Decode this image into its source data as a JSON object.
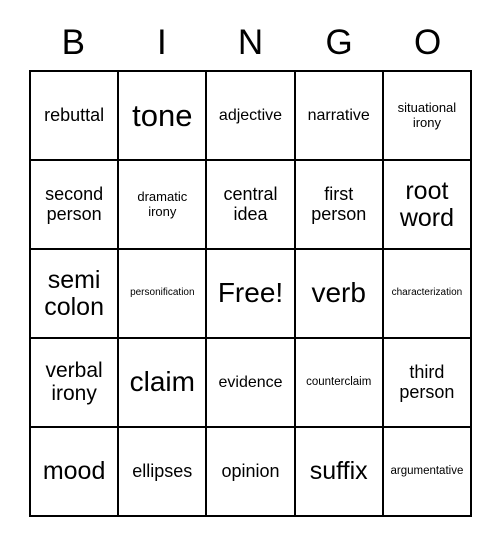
{
  "card": {
    "title": "BINGO",
    "header_letters": [
      "B",
      "I",
      "N",
      "G",
      "O"
    ],
    "free_space_label": "Free!",
    "colors": {
      "background": "#ffffff",
      "grid_line": "#000000",
      "text": "#000000"
    },
    "grid_size": "5x5"
  },
  "grid": {
    "rows": [
      {
        "cells": [
          {
            "label": "rebuttal",
            "size": "fs-ml"
          },
          {
            "label": "tone",
            "size": "fs-huge"
          },
          {
            "label": "adjective",
            "size": "fs-m"
          },
          {
            "label": "narrative",
            "size": "fs-m"
          },
          {
            "label": "situational irony",
            "size": "fs-sm"
          }
        ]
      },
      {
        "cells": [
          {
            "label": "second person",
            "size": "fs-ml"
          },
          {
            "label": "dramatic irony",
            "size": "fs-sm"
          },
          {
            "label": "central idea",
            "size": "fs-ml"
          },
          {
            "label": "first person",
            "size": "fs-ml"
          },
          {
            "label": "root word",
            "size": "fs-xl"
          }
        ]
      },
      {
        "cells": [
          {
            "label": "semi colon",
            "size": "fs-xl"
          },
          {
            "label": "personification",
            "size": "fs-xs"
          },
          {
            "label": "Free!",
            "size": "fs-xxl"
          },
          {
            "label": "verb",
            "size": "fs-xxl"
          },
          {
            "label": "characterization",
            "size": "fs-xs"
          }
        ]
      },
      {
        "cells": [
          {
            "label": "verbal irony",
            "size": "fs-l"
          },
          {
            "label": "claim",
            "size": "fs-xxl"
          },
          {
            "label": "evidence",
            "size": "fs-m"
          },
          {
            "label": "counterclaim",
            "size": "fs-s"
          },
          {
            "label": "third person",
            "size": "fs-ml"
          }
        ]
      },
      {
        "cells": [
          {
            "label": "mood",
            "size": "fs-xl"
          },
          {
            "label": "ellipses",
            "size": "fs-ml"
          },
          {
            "label": "opinion",
            "size": "fs-ml"
          },
          {
            "label": "suffix",
            "size": "fs-xl"
          },
          {
            "label": "argumentative",
            "size": "fs-s"
          }
        ]
      }
    ]
  }
}
